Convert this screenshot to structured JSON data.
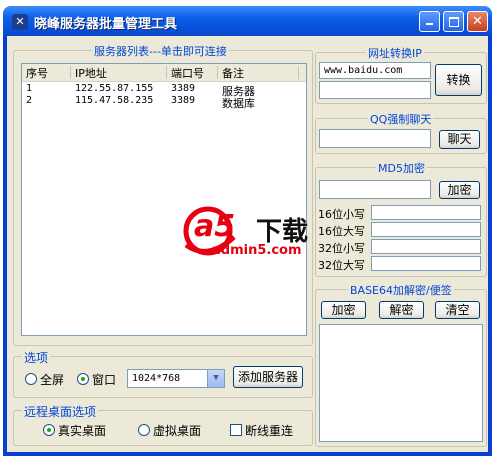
{
  "window": {
    "title": "晓峰服务器批量管理工具",
    "minimize_icon": "minimize-icon",
    "maximize_icon": "maximize-icon",
    "close_icon": "close-icon"
  },
  "server_list": {
    "group_title": "服务器列表---单击即可连接",
    "columns": [
      "序号",
      "IP地址",
      "端口号",
      "备注"
    ],
    "rows": [
      {
        "index": "1",
        "ip": "122.55.87.155",
        "port": "3389",
        "note": "服务器"
      },
      {
        "index": "2",
        "ip": "115.47.58.235",
        "port": "3389",
        "note": "数据库"
      }
    ]
  },
  "options": {
    "group_title": "选项",
    "fullscreen_label": "全屏",
    "window_label": "窗口",
    "selected_mode": "窗口",
    "resolution_value": "1024*768",
    "add_server_label": "添加服务器"
  },
  "desktop": {
    "group_title": "远程桌面选项",
    "real_desktop_label": "真实桌面",
    "virtual_desktop_label": "虚拟桌面",
    "reconnect_label": "断线重连",
    "selected": "真实桌面",
    "reconnect_checked": false
  },
  "url_convert": {
    "group_title": "网址转换IP",
    "url_value": "www.baidu.com",
    "result_value": "",
    "convert_label": "转换"
  },
  "qq_chat": {
    "group_title": "QQ强制聊天",
    "qq_value": "",
    "chat_label": "聊天"
  },
  "md5": {
    "group_title": "MD5加密",
    "input_value": "",
    "encrypt_label": "加密",
    "labels": [
      "16位小写",
      "16位大写",
      "32位小写",
      "32位大写"
    ],
    "values": [
      "",
      "",
      "",
      ""
    ]
  },
  "base64": {
    "group_title": "BASE64加解密/便签",
    "encrypt_label": "加密",
    "decrypt_label": "解密",
    "clear_label": "清空",
    "text_value": ""
  },
  "watermark": {
    "logo_text": "a5",
    "download_text": "下载",
    "site_text": "admin5.com",
    "color": "#e60012"
  }
}
